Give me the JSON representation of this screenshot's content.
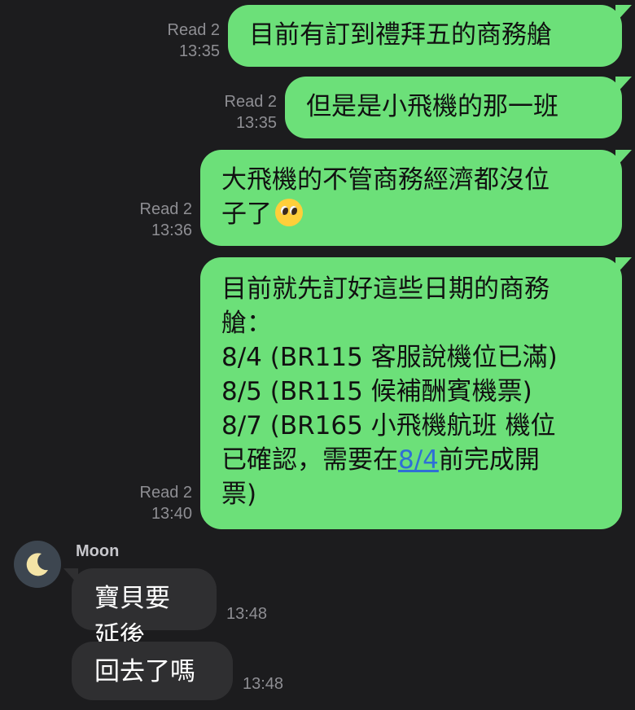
{
  "messages_out": [
    {
      "status": "Read 2",
      "time": "13:35",
      "lines": [
        "目前有訂到禮拜五的商務艙"
      ]
    },
    {
      "status": "Read 2",
      "time": "13:35",
      "lines": [
        "但是是小飛機的那一班"
      ]
    },
    {
      "status": "Read 2",
      "time": "13:36",
      "lines": [
        "大飛機的不管商務經濟都沒位",
        "子了"
      ],
      "emoji": "pleading-face"
    },
    {
      "status": "Read 2",
      "time": "13:40",
      "lines": [
        "目前就先訂好這些日期的商務",
        "艙：",
        "8/4 (BR115 客服說機位已滿)",
        "8/5  (BR115 候補酬賓機票)",
        "8/7 (BR165 小飛機航班 機位",
        "已確認，需要在",
        "前完成開",
        "票)"
      ],
      "link": "8/4"
    }
  ],
  "contact": {
    "name": "Moon",
    "avatar_icon": "crescent-moon-icon"
  },
  "messages_in": [
    {
      "text": "寶貝要延後",
      "time": "13:48"
    },
    {
      "text": "回去了嗎",
      "time": "13:48"
    }
  ],
  "colors": {
    "out_bubble": "#6ce079",
    "in_bubble": "#2f2f31",
    "background": "#1c1c1e",
    "link": "#2f6fd6"
  }
}
